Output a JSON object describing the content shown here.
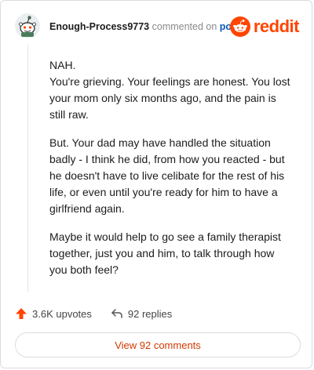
{
  "header": {
    "username": "Enough-Process9773",
    "commented_text": "commented on",
    "post_link": "post",
    "brand": "reddit"
  },
  "comment": {
    "paragraphs": [
      "NAH.\nYou're grieving. Your feelings are honest. You lost your mom only six months ago, and the pain is still raw.",
      "But. Your dad may have handled the situation badly - I think he did, from how you reacted - but he doesn't have to live celibate for the rest of his life, or even until you're ready for him to have a girlfriend again.",
      "Maybe it would help to go see a family therapist together, just you and him, to talk through how you both feel?"
    ]
  },
  "actions": {
    "upvotes": "3.6K upvotes",
    "replies": "92 replies"
  },
  "footer": {
    "view_comments": "View 92 comments"
  },
  "colors": {
    "brand": "#ff4500",
    "upvote": "#ff4500",
    "link": "#0a58b6",
    "view_button_text": "#d23a00"
  },
  "icons": {
    "avatar": "snoo-avatar",
    "logo": "reddit-logo-icon",
    "upvote": "upvote-arrow-icon",
    "reply": "reply-arrow-icon"
  }
}
